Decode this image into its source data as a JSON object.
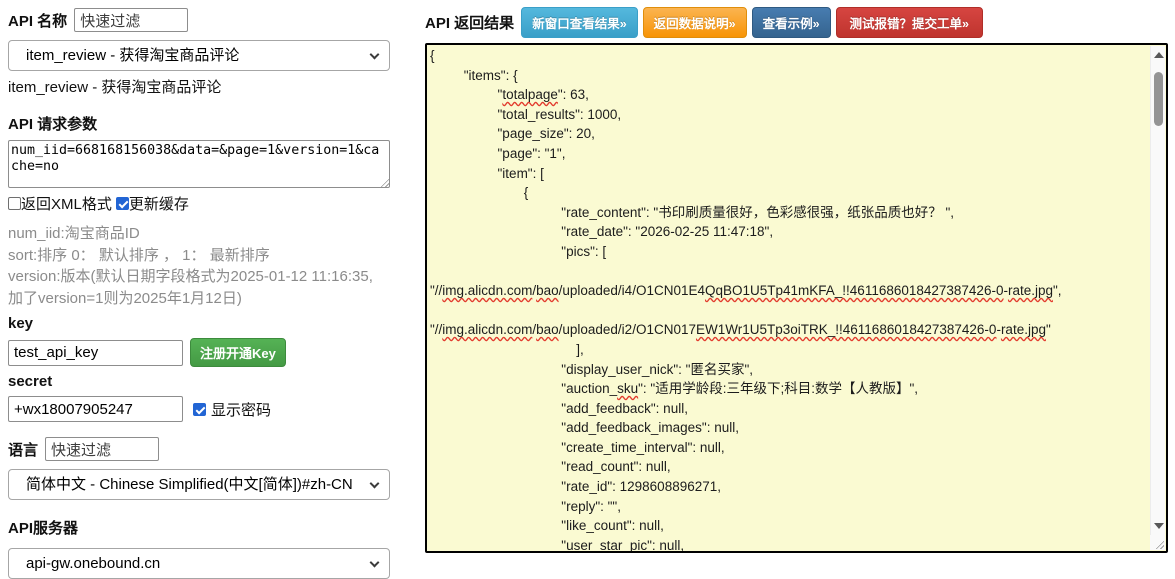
{
  "left": {
    "api_name_label": "API 名称",
    "api_name_filter_value": "快速过滤",
    "api_select_value": "item_review - 获得淘宝商品评论",
    "api_selected_text": "item_review - 获得淘宝商品评论",
    "params_heading": "API 请求参数",
    "params_value": "num_iid=668168156038&data=&page=1&version=1&cache=no",
    "xml_checkbox_label": "返回XML格式",
    "cache_checkbox_label": "更新缓存",
    "param_help": [
      "num_iid:淘宝商品ID",
      "sort:排序 0： 默认排序 ， 1： 最新排序",
      "version:版本(默认日期字段格式为2025-01-12 11:16:35, 加了version=1则为2025年1月12日)"
    ],
    "key_label": "key",
    "key_value": "test_api_key",
    "register_button": "注册开通Key",
    "secret_label": "secret",
    "secret_value": "+wx18007905247",
    "show_password_label": "显示密码",
    "language_label": "语言",
    "language_filter_value": "快速过滤",
    "language_select_value": "简体中文 - Chinese Simplified(中文[简体])#zh-CN",
    "server_label": "API服务器",
    "server_select_value": "api-gw.onebound.cn"
  },
  "right": {
    "title": "API 返回结果",
    "buttons": [
      {
        "label": "新窗口查看结果»",
        "color": "#49a7d4"
      },
      {
        "label": "返回数据说明»",
        "color": "#f89406"
      },
      {
        "label": "查看示例»",
        "color": "#3b6ea5"
      },
      {
        "label": "测试报错？提交工单»",
        "color": "#c9342e"
      }
    ],
    "result_lines": [
      "{",
      "         \"items\": {",
      "                  \"§totalpage§\": 63,",
      "                  \"total_results\": 1000,",
      "                  \"page_size\": 20,",
      "                  \"page\": \"1\",",
      "                  \"item\": [",
      "                         {",
      "                                   \"rate_content\": \"书印刷质量很好，色彩感很强，纸张品质也好？ \",",
      "                                   \"rate_date\": \"2026-02-25 11:47:18\",",
      "                                   \"pics\": [",
      "",
      "\"//§img.alicdn.com§/§bao§/uploaded/i4/O1CN01E4§QqBO1U5Tp41mKFA_!!4611686018427387426-0§-§rate.jpg§\",",
      "",
      "\"//§img.alicdn.com§/§bao§/uploaded/i2/O1CN017§EW1Wr1U5Tp3oiTRK_!!4611686018427387426-0§-§rate.jpg§\"",
      "                                       ],",
      "                                   \"display_user_nick\": \"匿名买家\",",
      "                                   \"auction_§sku§\": \"适用学龄段:三年级下;科目:数学【人教版】\",",
      "                                   \"add_feedback\": null,",
      "                                   \"add_feedback_images\": null,",
      "                                   \"create_time_interval\": null,",
      "                                   \"read_count\": null,",
      "                                   \"rate_id\": 1298608896271,",
      "                                   \"reply\": \"\",",
      "                                   \"like_count\": null,",
      "                                   \"user_star_pic\": null,"
    ]
  }
}
